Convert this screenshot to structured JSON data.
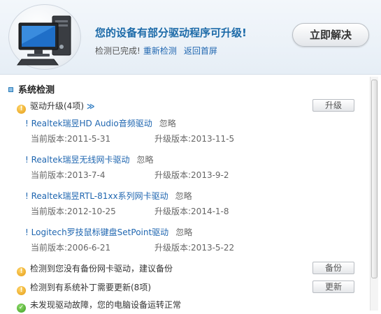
{
  "header": {
    "headline": "您的设备有部分驱动程序可升级!",
    "status": "检测已完成!",
    "recheck_link": "重新检测",
    "home_link": "返回首屏",
    "fix_button": "立即解决"
  },
  "section": {
    "title": "系统检测"
  },
  "driver_upgrade": {
    "title": "驱动升级(4项)",
    "chevron": "≫",
    "button": "升级",
    "ignore_label": "忽略",
    "items": [
      {
        "name": "! Realtek瑞昱HD Audio音频驱动",
        "ignore": "忽略",
        "current": "当前版本:2011-5-31",
        "upgrade": "升级版本:2013-11-5"
      },
      {
        "name": "! Realtek瑞昱无线网卡驱动",
        "ignore": "忽略",
        "current": "当前版本:2013-7-4",
        "upgrade": "升级版本:2013-9-2"
      },
      {
        "name": "! Realtek瑞昱RTL-81xx系列网卡驱动",
        "ignore": "忽略",
        "current": "当前版本:2012-10-25",
        "upgrade": "升级版本:2014-1-8"
      },
      {
        "name": "! Logitech罗技鼠标键盘SetPoint驱动",
        "ignore": "忽略",
        "current": "当前版本:2006-6-21",
        "upgrade": "升级版本:2013-5-22"
      }
    ]
  },
  "backup": {
    "text": "检测到您没有备份网卡驱动，建议备份",
    "button": "备份"
  },
  "patch": {
    "text": "检测到有系统补丁需要更新(8项)",
    "button": "更新"
  },
  "ok_status": {
    "text": "未发现驱动故障，您的电脑设备运转正常"
  },
  "icons": {
    "warning": "warning-icon",
    "ok": "check-icon",
    "computer": "computer-icon"
  },
  "colors": {
    "link": "#1f66b0",
    "headline": "#1c6aa8",
    "warning": "#e49a12",
    "ok": "#3f9d22"
  }
}
